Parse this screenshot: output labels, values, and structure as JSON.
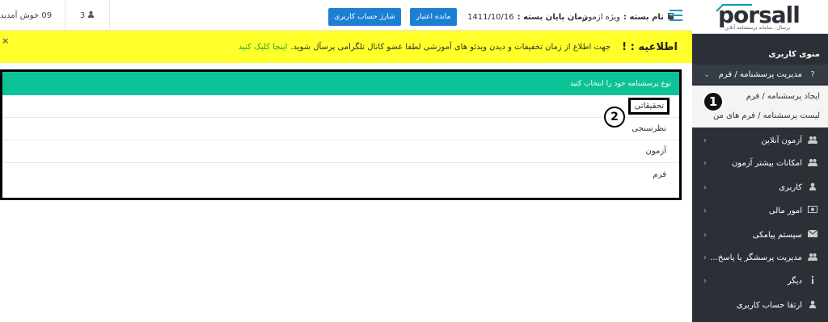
{
  "header": {
    "welcome_text": "09 خوش آمدید",
    "user_count": "3",
    "charge_button": "شارژ حساب کاربری",
    "remaining_button": "مانده اعتبار",
    "package_end_label": "زمان پایان بسته :",
    "package_end_date": "1411/10/16",
    "package_name_label": "نام بسته :",
    "package_name_value": "ویژه ازمون"
  },
  "alert": {
    "title": "اطلاعیه : !",
    "message": "جهت اطلاع از زمان تخفیفات و دیدن ویدئو های آموزشی لطفا عضو کانال تلگرامی پرسآل شوید.",
    "link": "اینجا کلیک کنید",
    "close": "×"
  },
  "sidebar": {
    "logo": "porsall",
    "logo_tagline": "پرسال . سامانه پرسشنامه آنلاین",
    "menu_title": "منوی کاربری",
    "items": [
      {
        "label": "مدیریت پرسشنامه / فرم",
        "icon": "?"
      },
      {
        "label": "آزمون آنلاین",
        "icon": "users-icon"
      },
      {
        "label": "امکانات بیشتر آزمون",
        "icon": "users-icon"
      },
      {
        "label": "کاربری",
        "icon": "user-icon"
      },
      {
        "label": "امور مالی",
        "icon": "money-icon"
      },
      {
        "label": "سیستم پیامکی",
        "icon": "envelope-icon"
      },
      {
        "label": "مدیریت پرسشگر یا پاسخ...",
        "icon": "users-icon"
      },
      {
        "label": "دیگر",
        "icon": "info-icon"
      },
      {
        "label": "ارتقا حساب کاربری",
        "icon": "user-icon"
      }
    ],
    "submenu": [
      {
        "label": "ایجاد پرسشنامه / فرم"
      },
      {
        "label": "لیست پرسشنامه / فرم های من"
      }
    ]
  },
  "panel": {
    "heading": "نوع پرسشنامه خود را انتخاب کنید",
    "options": [
      "تحقیقاتی",
      "نظرسنجی",
      "آزمون",
      "فرم"
    ]
  },
  "annotations": {
    "badge1": "1",
    "badge2": "2"
  }
}
